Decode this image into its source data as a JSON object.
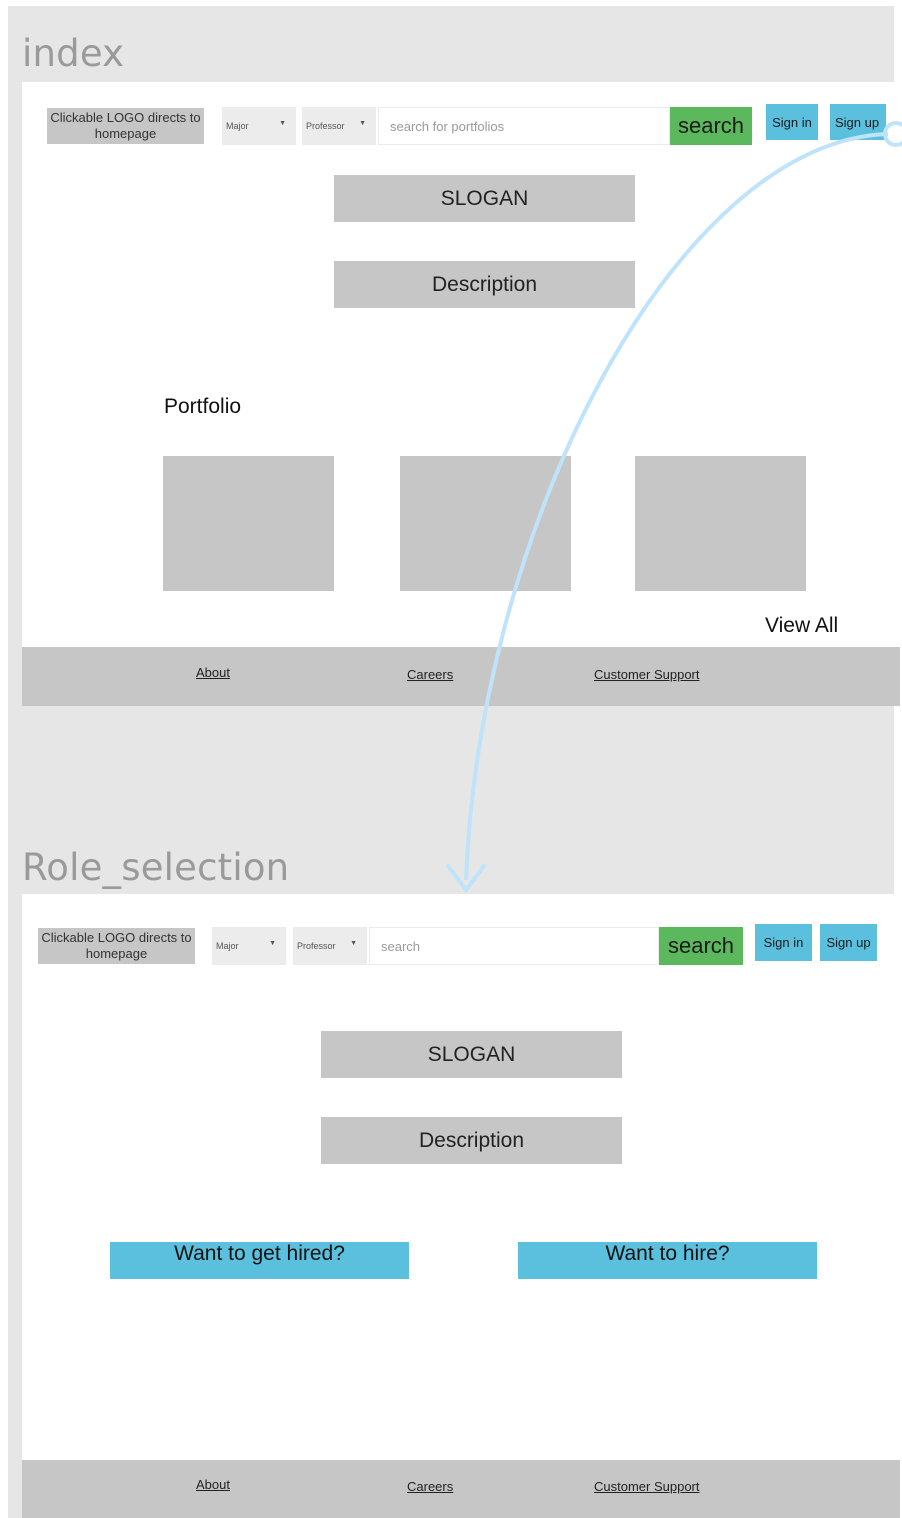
{
  "frames": {
    "index": {
      "title": "index",
      "header": {
        "logo": "Clickable LOGO directs to homepage",
        "major": "Major",
        "professor": "Professor",
        "search_placeholder": "search for portfolios",
        "search_button": "search",
        "sign_in": "Sign in",
        "sign_up": "Sign up"
      },
      "slogan": "SLOGAN",
      "description": "Description",
      "portfolio_heading": "Portfolio",
      "view_all": "View All",
      "footer": {
        "about": "About",
        "careers": "Careers",
        "support": "Customer Support"
      }
    },
    "role_selection": {
      "title": "Role_selection",
      "header": {
        "logo": "Clickable LOGO directs to homepage",
        "major": "Major",
        "professor": "Professor",
        "search_placeholder": "search",
        "search_button": "search",
        "sign_in": "Sign in",
        "sign_up": "Sign up"
      },
      "slogan": "SLOGAN",
      "description": "Description",
      "hired_button": "Want to get hired?",
      "hire_button": "Want to hire?",
      "footer": {
        "about": "About",
        "careers": "Careers",
        "support": "Customer Support"
      }
    }
  },
  "colors": {
    "canvas": "#e6e6e6",
    "placeholder_gray": "#c6c6c6",
    "search_green": "#5cb85c",
    "button_blue": "#5bc0de",
    "flow_arrow": "#bfe3fb"
  }
}
